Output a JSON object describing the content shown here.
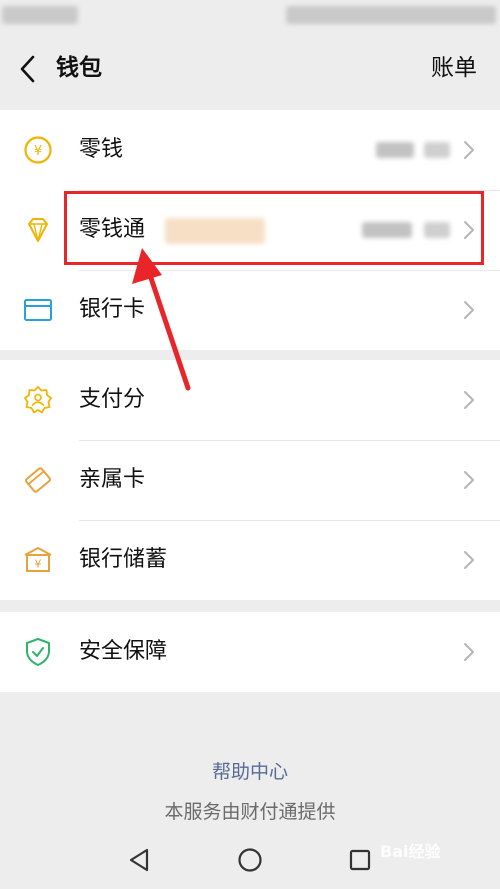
{
  "header": {
    "title": "钱包",
    "bill_label": "账单"
  },
  "wallet_items": [
    {
      "label": "零钱",
      "icon": "coin-yuan-icon"
    },
    {
      "label": "零钱通",
      "icon": "diamond-icon"
    },
    {
      "label": "银行卡",
      "icon": "bank-card-icon"
    }
  ],
  "service_items": [
    {
      "label": "支付分",
      "icon": "credit-score-icon"
    },
    {
      "label": "亲属卡",
      "icon": "family-card-icon"
    },
    {
      "label": "银行储蓄",
      "icon": "bank-savings-icon"
    }
  ],
  "security_items": [
    {
      "label": "安全保障",
      "icon": "shield-check-icon"
    }
  ],
  "footer": {
    "help_link": "帮助中心",
    "provider_text": "本服务由财付通提供"
  },
  "watermark": "Bai经验",
  "colors": {
    "accent_link": "#576b95",
    "icon_yellow": "#f0b400",
    "icon_blue": "#2a9fd8",
    "icon_orange": "#e9a13b",
    "icon_green": "#2fb36b",
    "annotation_red": "#e8262a"
  }
}
